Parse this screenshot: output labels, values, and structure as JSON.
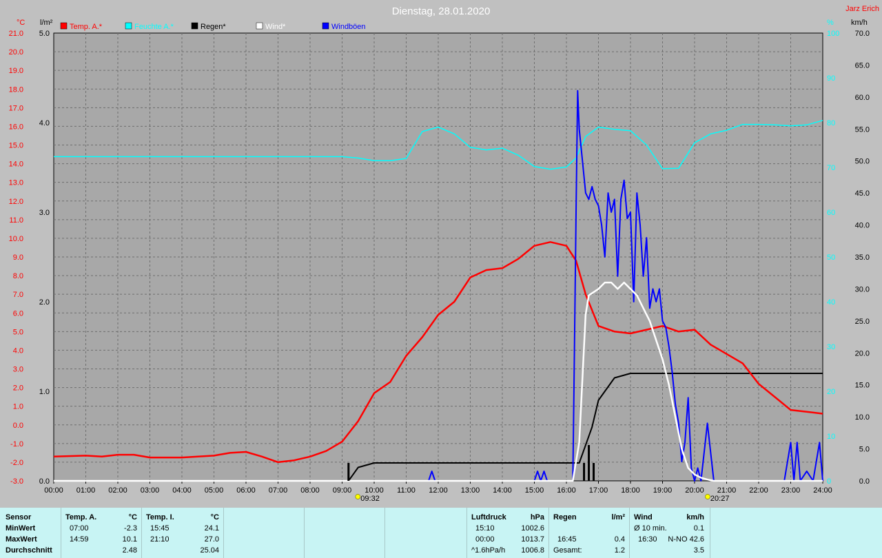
{
  "header": {
    "title": "Dienstag, 28.01.2020",
    "author": "Jarz Erich"
  },
  "colors": {
    "background": "#c0c0c0",
    "plot": "#a8a8a8",
    "temp": "#ff0000",
    "humidity": "#00ffff",
    "rain": "#000000",
    "wind": "#ffffff",
    "gusts": "#0000ff",
    "stats_bg": "#c8f4f4"
  },
  "chart_data": {
    "type": "line",
    "title": "Dienstag, 28.01.2020",
    "grid": true,
    "legend": "top",
    "x_ticks": [
      "00:00",
      "01:00",
      "02:00",
      "03:00",
      "04:00",
      "05:00",
      "06:00",
      "07:00",
      "08:00",
      "09:00",
      "10:00",
      "11:00",
      "12:00",
      "13:00",
      "14:00",
      "15:00",
      "16:00",
      "17:00",
      "18:00",
      "19:00",
      "20:00",
      "21:00",
      "22:00",
      "23:00",
      "24:00"
    ],
    "xlim": [
      0,
      24
    ],
    "axes": {
      "temp": {
        "unit": "°C",
        "min": -3,
        "max": 21,
        "ticks": [
          "-3.0",
          "-2.0",
          "-1.0",
          "0.0",
          "1.0",
          "2.0",
          "3.0",
          "4.0",
          "5.0",
          "6.0",
          "7.0",
          "8.0",
          "9.0",
          "10.0",
          "11.0",
          "12.0",
          "13.0",
          "14.0",
          "15.0",
          "16.0",
          "17.0",
          "18.0",
          "19.0",
          "20.0",
          "21.0"
        ]
      },
      "rain": {
        "unit": "l/m²",
        "min": 0,
        "max": 5,
        "ticks": [
          "0.0",
          "1.0",
          "2.0",
          "3.0",
          "4.0",
          "5.0"
        ]
      },
      "humidity": {
        "unit": "%",
        "min": 0,
        "max": 100,
        "ticks": [
          "0",
          "10",
          "20",
          "30",
          "40",
          "50",
          "60",
          "70",
          "80",
          "90",
          "100"
        ]
      },
      "wind": {
        "unit": "km/h",
        "min": 0,
        "max": 70,
        "ticks": [
          "0.0",
          "5.0",
          "10.0",
          "15.0",
          "20.0",
          "25.0",
          "30.0",
          "35.0",
          "40.0",
          "45.0",
          "50.0",
          "55.0",
          "60.0",
          "65.0",
          "70.0"
        ]
      }
    },
    "sun_markers": [
      {
        "label": "09:32",
        "x": 9.533
      },
      {
        "label": "20:27",
        "x": 20.45
      }
    ],
    "series": [
      {
        "name": "Temp. A.*",
        "axis": "temp",
        "color": "#ff0000",
        "x": [
          0,
          1,
          1.5,
          2,
          2.5,
          3,
          4,
          5,
          5.5,
          6,
          6.5,
          7,
          7.5,
          8,
          8.5,
          9,
          9.5,
          10,
          10.5,
          11,
          11.5,
          12,
          12.5,
          13,
          13.5,
          14,
          14.5,
          15,
          15.5,
          16,
          16.3,
          16.6,
          17,
          17.5,
          18,
          18.5,
          19,
          19.5,
          20,
          20.5,
          21,
          21.5,
          22,
          22.5,
          23,
          23.5,
          24
        ],
        "y": [
          -1.7,
          -1.65,
          -1.7,
          -1.6,
          -1.6,
          -1.75,
          -1.75,
          -1.65,
          -1.5,
          -1.45,
          -1.7,
          -2.0,
          -1.9,
          -1.7,
          -1.4,
          -0.9,
          0.2,
          1.7,
          2.3,
          3.7,
          4.7,
          5.9,
          6.6,
          7.9,
          8.3,
          8.4,
          8.9,
          9.6,
          9.8,
          9.6,
          8.8,
          7.0,
          5.3,
          5.0,
          4.9,
          5.1,
          5.3,
          5.0,
          5.1,
          4.3,
          3.8,
          3.3,
          2.2,
          1.5,
          0.8,
          0.7,
          0.6
        ]
      },
      {
        "name": "Feuchte A.*",
        "axis": "humidity",
        "color": "#00ffff",
        "x": [
          0,
          2,
          4,
          6,
          8,
          9,
          9.5,
          10,
          10.5,
          11,
          11.5,
          12,
          12.5,
          13,
          13.5,
          14,
          14.5,
          15,
          15.5,
          16,
          16.3,
          16.6,
          17,
          17.5,
          18,
          18.5,
          19,
          19.5,
          20,
          20.5,
          21,
          21.5,
          22,
          22.5,
          23,
          23.5,
          24
        ],
        "y": [
          72.4,
          72.4,
          72.4,
          72.4,
          72.4,
          72.4,
          72.1,
          71.5,
          71.5,
          72.0,
          78.0,
          79.0,
          77.5,
          74.5,
          73.9,
          74.3,
          72.7,
          70.2,
          69.6,
          70.1,
          72.1,
          76.9,
          79.0,
          78.5,
          78.2,
          75.0,
          69.7,
          69.8,
          75.5,
          77.5,
          78.3,
          79.6,
          79.6,
          79.5,
          79.3,
          79.5,
          80.5
        ]
      },
      {
        "name": "Regen*",
        "axis": "rain",
        "color": "#000000",
        "x": [
          0,
          9.2,
          9.5,
          10,
          11,
          12,
          13,
          14,
          15,
          16,
          16.4,
          16.5,
          16.8,
          17,
          17.5,
          18,
          19,
          20,
          21,
          22,
          23,
          24
        ],
        "y": [
          0,
          0,
          0.15,
          0.2,
          0.2,
          0.2,
          0.2,
          0.2,
          0.2,
          0.2,
          0.2,
          0.3,
          0.6,
          0.9,
          1.15,
          1.2,
          1.2,
          1.2,
          1.2,
          1.2,
          1.2,
          1.2
        ]
      },
      {
        "name": "Wind*",
        "axis": "wind",
        "color": "#ffffff",
        "x": [
          0,
          16.2,
          16.4,
          16.6,
          16.7,
          17,
          17.2,
          17.4,
          17.6,
          17.8,
          18,
          18.2,
          18.4,
          18.6,
          18.8,
          19,
          19.2,
          19.4,
          19.6,
          19.8,
          20,
          20.2,
          20.4,
          20.6,
          21,
          21.5,
          22,
          24
        ],
        "y": [
          0,
          0,
          6,
          26,
          29,
          30,
          31,
          31,
          30,
          31,
          30,
          29,
          27,
          25,
          22,
          19,
          15,
          10,
          5,
          2,
          1,
          0.5,
          0.2,
          0,
          0,
          0,
          0,
          0
        ]
      },
      {
        "name": "Windböen",
        "axis": "wind",
        "color": "#0000ff",
        "x": [
          0,
          11.7,
          11.8,
          11.9,
          12.0,
          15.0,
          15.1,
          15.2,
          15.3,
          15.4,
          16.2,
          16.25,
          16.3,
          16.35,
          16.4,
          16.5,
          16.6,
          16.7,
          16.8,
          16.9,
          17,
          17.1,
          17.2,
          17.3,
          17.4,
          17.5,
          17.6,
          17.7,
          17.8,
          17.9,
          18,
          18.1,
          18.2,
          18.3,
          18.4,
          18.5,
          18.6,
          18.7,
          18.8,
          18.9,
          19,
          19.1,
          19.2,
          19.3,
          19.4,
          19.5,
          19.6,
          19.7,
          19.8,
          19.9,
          20,
          20.1,
          20.2,
          20.4,
          20.6,
          20.8,
          21,
          21.2,
          22.8,
          23.0,
          23.1,
          23.2,
          23.3,
          23.5,
          23.7,
          23.9,
          24
        ],
        "y": [
          0,
          0,
          1.5,
          0,
          0,
          0,
          1.5,
          0,
          1.5,
          0,
          0,
          20,
          42,
          61,
          55,
          50,
          45,
          44,
          46,
          44,
          43,
          40,
          35,
          45,
          42,
          44,
          32,
          44,
          47,
          41,
          42,
          28,
          45,
          40,
          32,
          38,
          27,
          30,
          28,
          30,
          25,
          24,
          21,
          17,
          12,
          9,
          3,
          6,
          13,
          2,
          0,
          2,
          0,
          9,
          0,
          0,
          0,
          0,
          0,
          6,
          0,
          6,
          0,
          1.5,
          0,
          6,
          0
        ]
      }
    ]
  },
  "stats": {
    "sensor": {
      "label": "Sensor",
      "rows": [
        "MinWert",
        "MaxWert",
        "Durchschnitt"
      ]
    },
    "temp_a": {
      "title": "Temp. A.",
      "unit": "°C",
      "min_time": "07:00",
      "min_val": "-2.3",
      "max_time": "14:59",
      "max_val": "10.1",
      "avg": "2.48"
    },
    "temp_i": {
      "title": "Temp. I.",
      "unit": "°C",
      "min_time": "15:45",
      "min_val": "24.1",
      "max_time": "21:10",
      "max_val": "27.0",
      "avg": "25.04"
    },
    "pressure": {
      "title": "Luftdruck",
      "unit": "hPa",
      "min_time": "15:10",
      "min_val": "1002.6",
      "max_time": "00:00",
      "max_val": "1013.7",
      "avg_label": "^1.6hPa/h",
      "avg": "1006.8"
    },
    "rain": {
      "title": "Regen",
      "unit": "l/m²",
      "max_time": "16:45",
      "max_val": "0.4",
      "total_label": "Gesamt:",
      "total": "1.2"
    },
    "wind": {
      "title": "Wind",
      "unit": "km/h",
      "min_label": "Ø 10 min.",
      "min_val": "0.1",
      "max_time": "16:30",
      "max_val": "N-NO 42.6",
      "avg": "3.5"
    }
  }
}
